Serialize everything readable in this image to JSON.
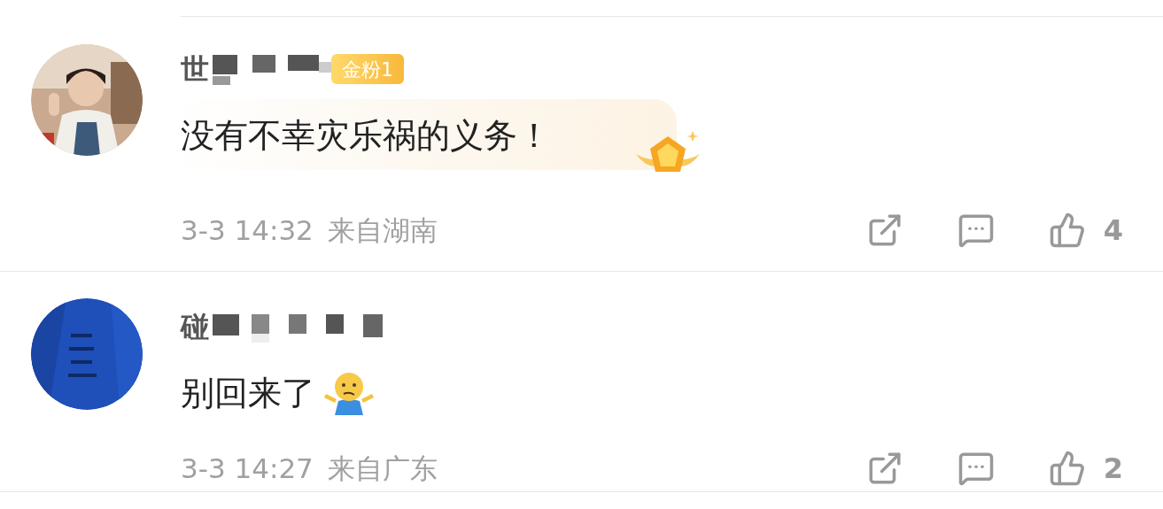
{
  "comments": [
    {
      "name": "世",
      "redacted": true,
      "badge": "金粉1",
      "text": "没有不幸灾乐祸的义务！",
      "medal": true,
      "time": "3-3 14:32",
      "location": "来自湖南",
      "likes": "4"
    },
    {
      "name": "碰",
      "redacted": true,
      "text": "别回来了",
      "shrug_emoji": true,
      "time": "3-3 14:27",
      "location": "来自广东",
      "likes": "2"
    }
  ]
}
